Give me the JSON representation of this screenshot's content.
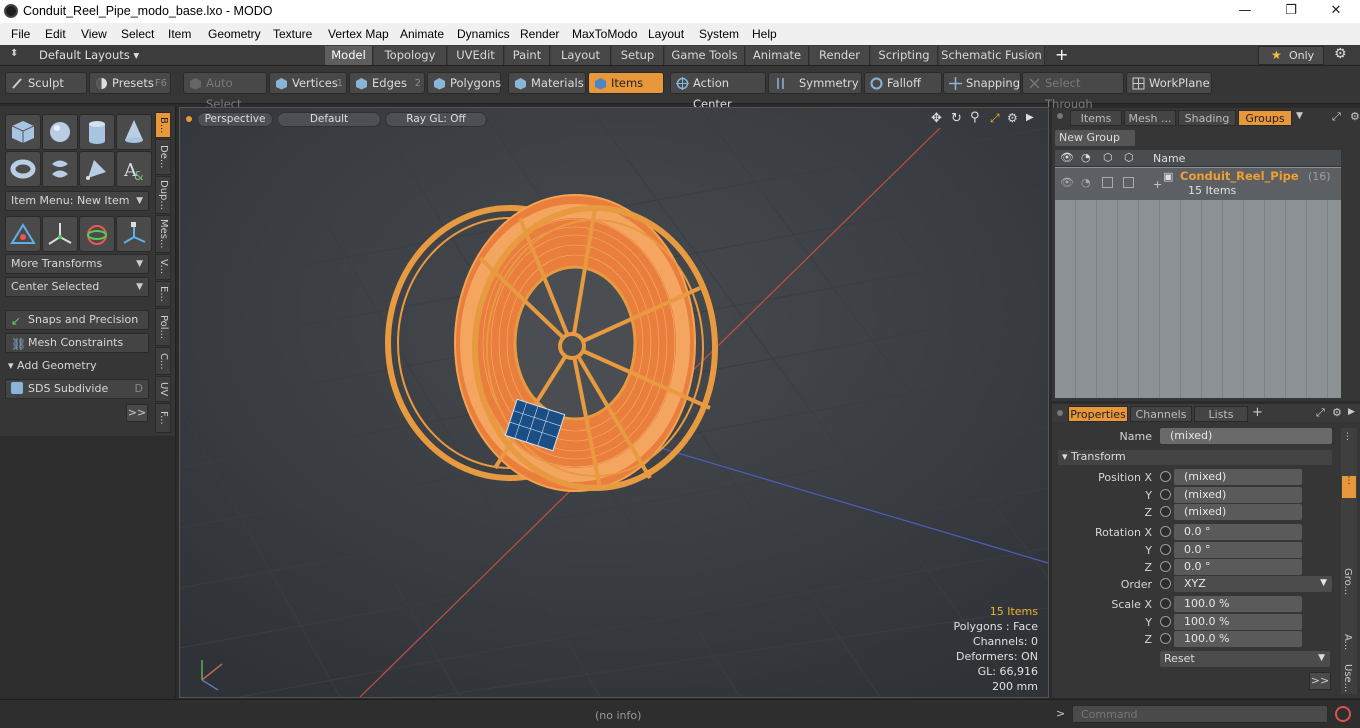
{
  "window": {
    "title": "Conduit_Reel_Pipe_modo_base.lxo - MODO",
    "minimize": "—",
    "maximize": "❐",
    "close": "✕"
  },
  "menu": [
    "File",
    "Edit",
    "View",
    "Select",
    "Item",
    "Geometry",
    "Texture",
    "Vertex Map",
    "Animate",
    "Dynamics",
    "Render",
    "MaxToModo",
    "Layout",
    "System",
    "Help"
  ],
  "layouts": {
    "dropdown": "Default Layouts",
    "tabs": [
      "Model",
      "Topology",
      "UVEdit",
      "Paint",
      "Layout",
      "Setup",
      "Game Tools",
      "Animate",
      "Render",
      "Scripting",
      "Schematic Fusion"
    ],
    "active": "Model",
    "add": "+",
    "only": "Only",
    "only_star": "★"
  },
  "toolbar": {
    "sculpt": "Sculpt",
    "presets": "Presets",
    "presets_key": "F6",
    "auto_select": "Auto Select",
    "vertices": "Vertices",
    "vertices_num": "1",
    "edges": "Edges",
    "edges_num": "2",
    "polygons": "Polygons",
    "materials": "Materials",
    "items": "Items",
    "action_center": "Action Center",
    "symmetry": "Symmetry",
    "falloff": "Falloff",
    "snapping": "Snapping",
    "select_through": "Select Through",
    "workplane": "WorkPlane"
  },
  "left": {
    "item_menu": "Item Menu: New Item",
    "more_transforms": "More Transforms",
    "center_selected": "Center Selected",
    "snaps": "Snaps and Precision",
    "mesh_constraints": "Mesh Constraints",
    "add_geometry": "Add Geometry",
    "sds": "SDS Subdivide",
    "sds_key": "D",
    "more": ">>",
    "vtabs": [
      "B...",
      "De...",
      "Dup...",
      "Mes...",
      "V...",
      "E...",
      "Pol...",
      "C...",
      "UV",
      "F..."
    ]
  },
  "viewport": {
    "view": "Perspective",
    "shading": "Default",
    "raygl": "Ray GL: Off",
    "hud": {
      "items": "15 Items",
      "polygons": "Polygons : Face",
      "channels": "Channels: 0",
      "deformers": "Deformers: ON",
      "gl": "GL: 66,916",
      "scale": "200 mm"
    }
  },
  "groups_panel": {
    "tabs": [
      "Items",
      "Mesh ...",
      "Shading",
      "Groups"
    ],
    "active": "Groups",
    "new_group": "New Group",
    "col_name": "Name",
    "row_name": "Conduit_Reel_Pipe",
    "row_count": "(16)",
    "row_sub": "15 Items"
  },
  "properties": {
    "tabs": [
      "Properties",
      "Channels",
      "Lists"
    ],
    "active": "Properties",
    "add": "+",
    "name_label": "Name",
    "name_value": "(mixed)",
    "transform": "Transform",
    "position_label": "Position X",
    "rotation_label": "Rotation X",
    "scale_label": "Scale X",
    "y": "Y",
    "z": "Z",
    "pos": [
      "(mixed)",
      "(mixed)",
      "(mixed)"
    ],
    "rot": [
      "0.0 °",
      "0.0 °",
      "0.0 °"
    ],
    "scl": [
      "100.0 %",
      "100.0 %",
      "100.0 %"
    ],
    "order_label": "Order",
    "order_value": "XYZ",
    "reset": "Reset",
    "more": ">>",
    "side_tabs": [
      "Gro...",
      "A...",
      "Use..."
    ]
  },
  "status": {
    "info": "(no info)",
    "command_placeholder": "Command",
    "prompt": ">"
  },
  "colors": {
    "accent": "#e8973a",
    "wire": "#f0a04e",
    "fill": "#e87f3c"
  }
}
